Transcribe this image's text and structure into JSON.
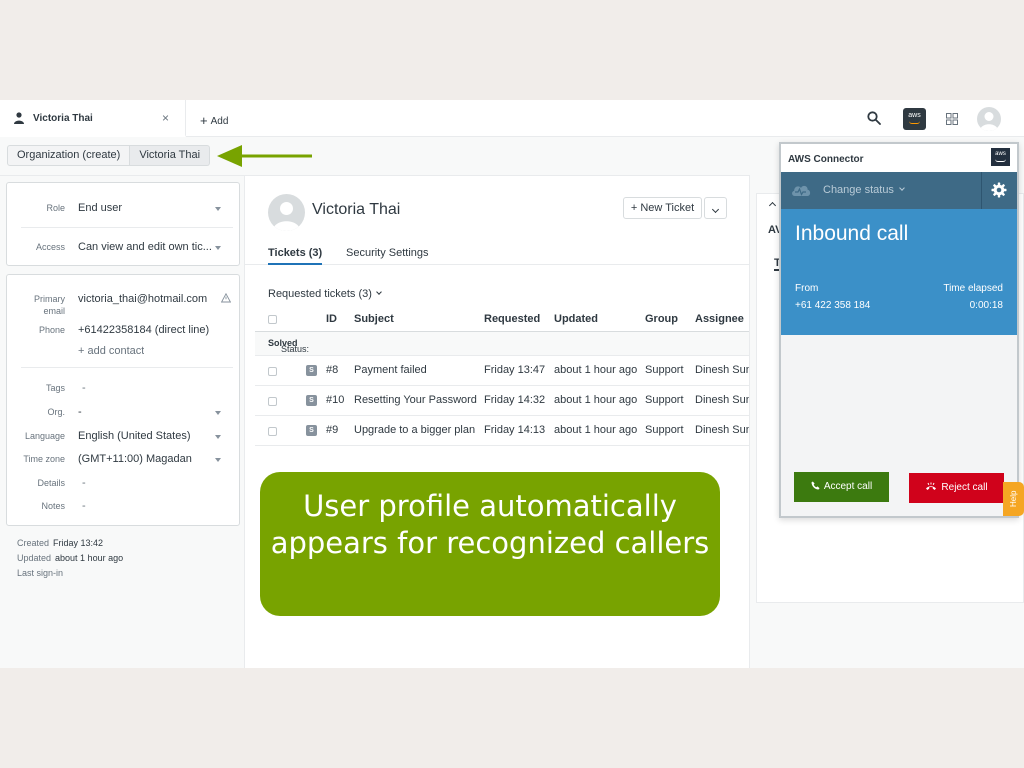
{
  "topbar": {
    "user_tab_label": "Victoria Thai",
    "close_symbol": "×",
    "add_label": "Add",
    "icons": [
      "person-icon",
      "close-icon",
      "plus-icon",
      "search-icon",
      "aws-icon",
      "apps-icon",
      "user-avatar"
    ]
  },
  "breadcrumb": {
    "items": [
      "Organization (create)",
      "Victoria Thai"
    ]
  },
  "sidebar": {
    "role_label": "Role",
    "role_value": "End user",
    "access_label": "Access",
    "access_value": "Can view and edit own tic...",
    "primary_email_label": "Primary email",
    "primary_email_value": "victoria_thai@hotmail.com",
    "phone_label": "Phone",
    "phone_value": "+61422358184 (direct line)",
    "add_contact": "+ add contact",
    "tags_label": "Tags",
    "tags_value": "-",
    "org_label": "Org.",
    "org_value": "-",
    "language_label": "Language",
    "language_value": "English (United States)",
    "timezone_label": "Time zone",
    "timezone_value": "(GMT+11:00) Magadan",
    "details_label": "Details",
    "details_value": "-",
    "notes_label": "Notes",
    "notes_value": "-",
    "created_label": "Created",
    "created_value": "Friday 13:42",
    "updated_label": "Updated",
    "updated_value": "about 1 hour ago",
    "last_signin_label": "Last sign-in"
  },
  "main": {
    "user_name": "Victoria Thai",
    "new_ticket_label": "+ New Ticket",
    "tabs": [
      {
        "label": "Tickets (3)",
        "active": true
      },
      {
        "label": "Security Settings",
        "active": false
      }
    ],
    "requested_title": "Requested tickets (3)",
    "columns": [
      "ID",
      "Subject",
      "Requested",
      "Updated",
      "Group",
      "Assignee"
    ],
    "status_group_label": "Status:",
    "status_group_value": "Solved",
    "rows": [
      {
        "badge": "S",
        "id": "#8",
        "subject": "Payment failed",
        "requested": "Friday 13:47",
        "updated": "about 1 hour ago",
        "group": "Support",
        "assignee": "Dinesh Sun"
      },
      {
        "badge": "S",
        "id": "#10",
        "subject": "Resetting Your Password",
        "requested": "Friday 14:32",
        "updated": "about 1 hour ago",
        "group": "Support",
        "assignee": "Dinesh Sun"
      },
      {
        "badge": "S",
        "id": "#9",
        "subject": "Upgrade to a bigger plan",
        "requested": "Friday 14:13",
        "updated": "about 1 hour ago",
        "group": "Support",
        "assignee": "Dinesh Sun"
      }
    ]
  },
  "callout": {
    "text": "User profile automatically appears for recognized callers"
  },
  "right_panel": {
    "title_fragment": "AV",
    "tab_fragment": "T"
  },
  "aws_connector": {
    "title": "AWS Connector",
    "logo_text": "aws",
    "change_status": "Change status",
    "call_title": "Inbound call",
    "from_label": "From",
    "from_value": "+61 422 358 184",
    "elapsed_label": "Time elapsed",
    "elapsed_value": "0:00:18",
    "accept_label": "Accept call",
    "reject_label": "Reject call"
  },
  "help_label": "Help",
  "colors": {
    "accent_green": "#78a300",
    "accept_green": "#3c7a0f",
    "reject_red": "#d0021b",
    "call_blue": "#3b90c8",
    "status_bar": "#3e6a86",
    "help_orange": "#f5a623",
    "tab_underline": "#1f73b7"
  }
}
